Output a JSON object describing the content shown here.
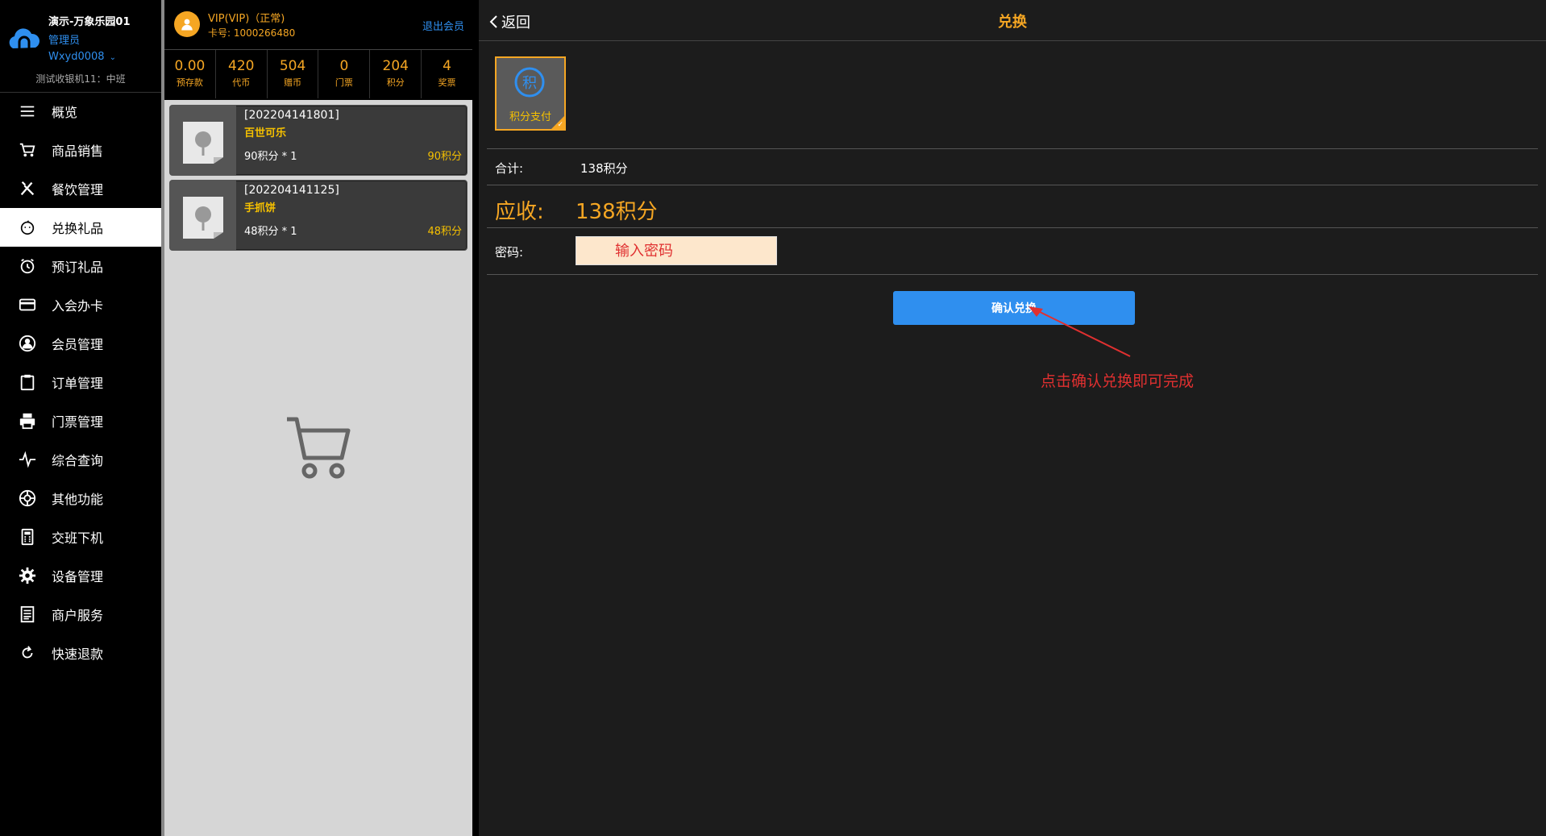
{
  "brand": {
    "store_name": "演示-万象乐园01",
    "role": "管理员",
    "user": "Wxyd0008",
    "shift": "测试收银机11：中班"
  },
  "nav": {
    "items": [
      {
        "label": "概览",
        "icon": "menu-icon"
      },
      {
        "label": "商品销售",
        "icon": "cart-icon"
      },
      {
        "label": "餐饮管理",
        "icon": "fork-knife-icon"
      },
      {
        "label": "兑换礼品",
        "icon": "gift-icon"
      },
      {
        "label": "预订礼品",
        "icon": "alarm-clock-icon"
      },
      {
        "label": "入会办卡",
        "icon": "credit-card-icon"
      },
      {
        "label": "会员管理",
        "icon": "user-icon"
      },
      {
        "label": "订单管理",
        "icon": "clipboard-icon"
      },
      {
        "label": "门票管理",
        "icon": "printer-icon"
      },
      {
        "label": "综合查询",
        "icon": "pulse-icon"
      },
      {
        "label": "其他功能",
        "icon": "aperture-icon"
      },
      {
        "label": "交班下机",
        "icon": "calculator-icon"
      },
      {
        "label": "设备管理",
        "icon": "gear-icon"
      },
      {
        "label": "商户服务",
        "icon": "document-icon"
      },
      {
        "label": "快速退款",
        "icon": "refresh-icon"
      }
    ],
    "active_index": 3
  },
  "member": {
    "vip_label": "VIP(VIP)（正常)",
    "card_prefix": "卡号:",
    "card_no": "1000266480",
    "logout": "退出会员",
    "stats": [
      {
        "value": "0.00",
        "label": "预存款"
      },
      {
        "value": "420",
        "label": "代币"
      },
      {
        "value": "504",
        "label": "赠币"
      },
      {
        "value": "0",
        "label": "门票"
      },
      {
        "value": "204",
        "label": "积分"
      },
      {
        "value": "4",
        "label": "奖票"
      }
    ]
  },
  "cart": {
    "items": [
      {
        "code": "[202204141801]",
        "name": "百世可乐",
        "qty": "90积分 * 1",
        "price": "90积分"
      },
      {
        "code": "[202204141125]",
        "name": "手抓饼",
        "qty": "48积分 * 1",
        "price": "48积分"
      }
    ]
  },
  "main": {
    "back_label": "返回",
    "title": "兑换",
    "pay_method": "积分支付",
    "pay_badge_char": "积",
    "total_label": "合计:",
    "total_value": "138积分",
    "due_label": "应收:",
    "due_value": "138积分",
    "password_label": "密码:",
    "password_placeholder": "输入密码",
    "confirm_label": "确认兑换",
    "annotation": "点击确认兑换即可完成"
  },
  "colors": {
    "accent": "#f5a623",
    "link": "#2f8fef",
    "annotation": "#e03030",
    "confirm_button": "#2f8fef"
  }
}
